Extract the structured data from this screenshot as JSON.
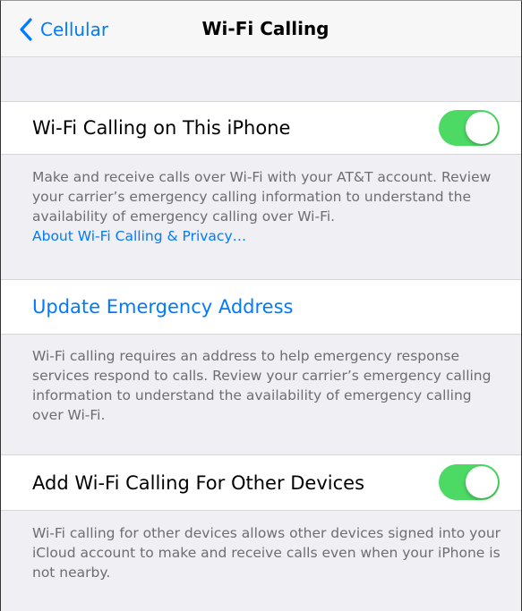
{
  "nav": {
    "back_label": "Cellular",
    "title": "Wi-Fi Calling"
  },
  "wifi_calling": {
    "label": "Wi-Fi Calling on This iPhone",
    "enabled": true,
    "footer_text": "Make and receive calls over Wi-Fi with your AT&T account. Review your carrier’s emergency calling information to understand the availability of emergency calling over Wi-Fi.",
    "footer_link": "About Wi-Fi Calling & Privacy…"
  },
  "emergency": {
    "label": "Update Emergency Address",
    "footer_text": "Wi-Fi calling requires an address to help emergency response services respond to calls. Review your carrier’s emergency calling information to understand the availability of emergency calling over Wi-Fi."
  },
  "other_devices": {
    "label": "Add Wi-Fi Calling For Other Devices",
    "enabled": true,
    "footer_text": "Wi-Fi calling for other devices allows other devices signed into your iCloud account to make and receive calls even when your iPhone is not nearby."
  },
  "colors": {
    "accent": "#007aff",
    "toggle_on": "#4cd964",
    "group_background": "#efeff4",
    "footer_text": "#6d6d72"
  }
}
